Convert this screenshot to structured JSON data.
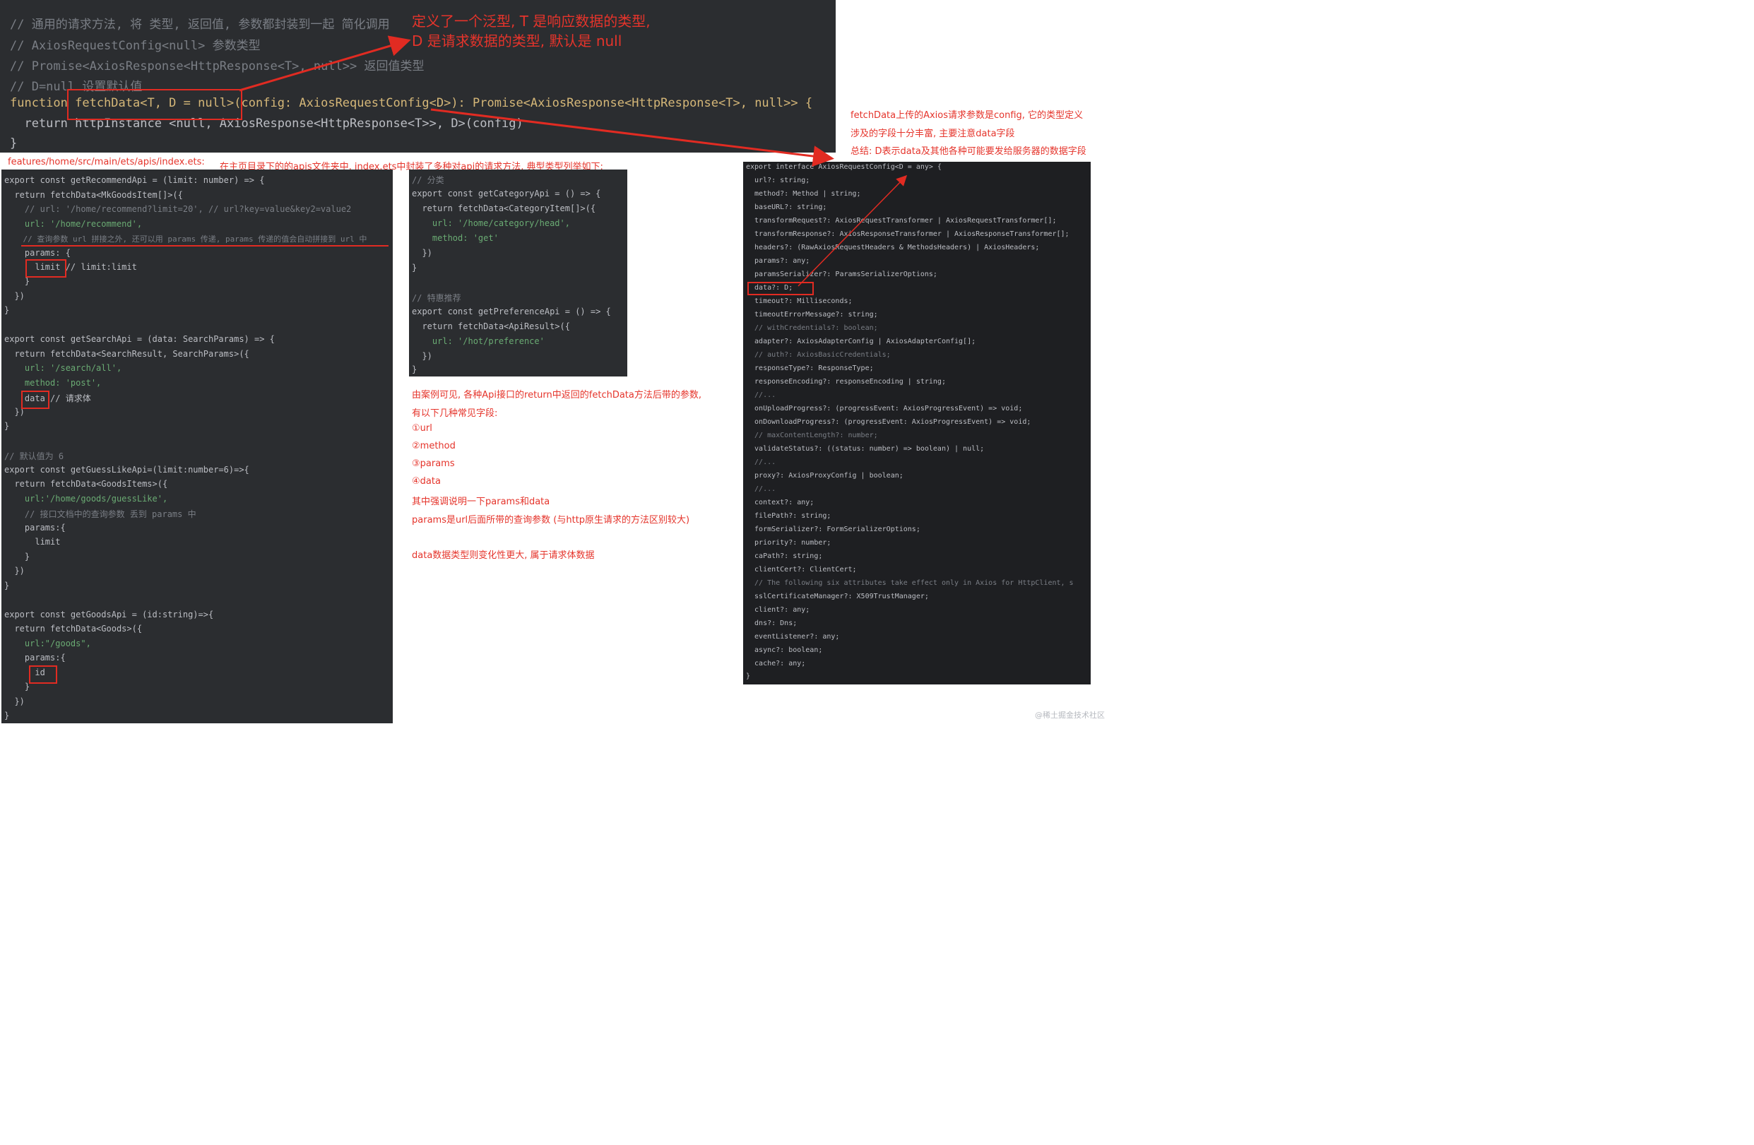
{
  "top": {
    "lines": [
      "// 通用的请求方法, 将 类型, 返回值, 参数都封装到一起 简化调用",
      "// AxiosRequestConfig<null> 参数类型",
      "// Promise<AxiosResponse<HttpResponse<T>, null>> 返回值类型",
      "// D=null 设置默认值",
      "function fetchData<T, D = null>(config: AxiosRequestConfig<D>): Promise<AxiosResponse<HttpResponse<T>, null>> {",
      "  return httpInstance <null, AxiosResponse<HttpResponse<T>>, D>(config)",
      "}"
    ]
  },
  "annotations": {
    "generic_note": [
      "定义了一个泛型, T 是响应数据的类型,",
      "D 是请求数据的类型, 默认是 null"
    ],
    "config_note": [
      "fetchData上传的Axios请求参数是config, 它的类型定义",
      "涉及的字段十分丰富, 主要注意data字段",
      "总结: D表示data及其他各种可能要发给服务器的数据字段"
    ],
    "path": "features/home/src/main/ets/apis/index.ets:",
    "path_desc": "在主页目录下的的apis文件夹中, index.ets中封装了多种对api的请求方法, 典型类型列举如下:",
    "summary": [
      "由案例可见, 各种Api接口的return中返回的fetchData方法后带的参数,",
      "有以下几种常见字段:",
      "①url",
      "②method",
      "③params",
      "④data",
      "其中强调说明一下params和data",
      "params是url后面所带的查询参数 (与http原生请求的方法区别较大)",
      "",
      "data数据类型则变化性更大, 属于请求体数据"
    ]
  },
  "left": {
    "lines": [
      "export const getRecommendApi = (limit: number) => {",
      "  return fetchData<MkGoodsItem[]>({",
      "    // url: '/home/recommend?limit=20', // url?key=value&key2=value2",
      "    url: '/home/recommend',",
      "    // 查询参数 url 拼接之外, 还可以用 params 传递, params 传递的值会自动拼接到 url 中",
      "    params: {",
      "      limit // limit:limit",
      "    }",
      "  })",
      "}",
      "",
      "export const getSearchApi = (data: SearchParams) => {",
      "  return fetchData<SearchResult, SearchParams>({",
      "    url: '/search/all',",
      "    method: 'post',",
      "    data // 请求体",
      "  })",
      "}",
      "",
      "// 默认值为 6",
      "export const getGuessLikeApi=(limit:number=6)=>{",
      "  return fetchData<GoodsItems>({",
      "    url:'/home/goods/guessLike',",
      "    // 接口文档中的查询参数 丢到 params 中",
      "    params:{",
      "      limit",
      "    }",
      "  })",
      "}",
      "",
      "export const getGoodsApi = (id:string)=>{",
      "  return fetchData<Goods>({",
      "    url:\"/goods\",",
      "    params:{",
      "      id",
      "    }",
      "  })",
      "}"
    ]
  },
  "middle": {
    "lines": [
      "// 分类",
      "export const getCategoryApi = () => {",
      "  return fetchData<CategoryItem[]>({",
      "    url: '/home/category/head',",
      "    method: 'get'",
      "  })",
      "}",
      "",
      "// 特惠推荐",
      "export const getPreferenceApi = () => {",
      "  return fetchData<ApiResult>({",
      "    url: '/hot/preference'",
      "  })",
      "}"
    ]
  },
  "right": {
    "lines": [
      "export interface AxiosRequestConfig<D = any> {",
      "  url?: string;",
      "  method?: Method | string;",
      "  baseURL?: string;",
      "  transformRequest?: AxiosRequestTransformer | AxiosRequestTransformer[];",
      "  transformResponse?: AxiosResponseTransformer | AxiosResponseTransformer[];",
      "  headers?: (RawAxiosRequestHeaders & MethodsHeaders) | AxiosHeaders;",
      "  params?: any;",
      "  paramsSerializer?: ParamsSerializerOptions;",
      "  data?: D;",
      "  timeout?: Milliseconds;",
      "  timeoutErrorMessage?: string;",
      "  // withCredentials?: boolean;",
      "  adapter?: AxiosAdapterConfig | AxiosAdapterConfig[];",
      "  // auth?: AxiosBasicCredentials;",
      "  responseType?: ResponseType;",
      "  responseEncoding?: responseEncoding | string;",
      "  //...",
      "  onUploadProgress?: (progressEvent: AxiosProgressEvent) => void;",
      "  onDownloadProgress?: (progressEvent: AxiosProgressEvent) => void;",
      "  // maxContentLength?: number;",
      "  validateStatus?: ((status: number) => boolean) | null;",
      "  //...",
      "  proxy?: AxiosProxyConfig | boolean;",
      "  //...",
      "  context?: any;",
      "  filePath?: string;",
      "  formSerializer?: FormSerializerOptions;",
      "  priority?: number;",
      "  caPath?: string;",
      "  clientCert?: ClientCert;",
      "  // The following six attributes take effect only in Axios for HttpClient, s",
      "  sslCertificateManager?: X509TrustManager;",
      "  client?: any;",
      "  dns?: Dns;",
      "  eventListener?: any;",
      "  async?: boolean;",
      "  cache?: any;",
      "}"
    ]
  },
  "watermark": "@稀土掘金技术社区",
  "colors": {
    "panel_bg": "#2b2d30",
    "annotation_red": "#e5342b",
    "comment": "#7a7e85",
    "keyword": "#cf8e6d",
    "function": "#56a8f5",
    "string": "#6aab73",
    "type": "#c77dbb"
  }
}
